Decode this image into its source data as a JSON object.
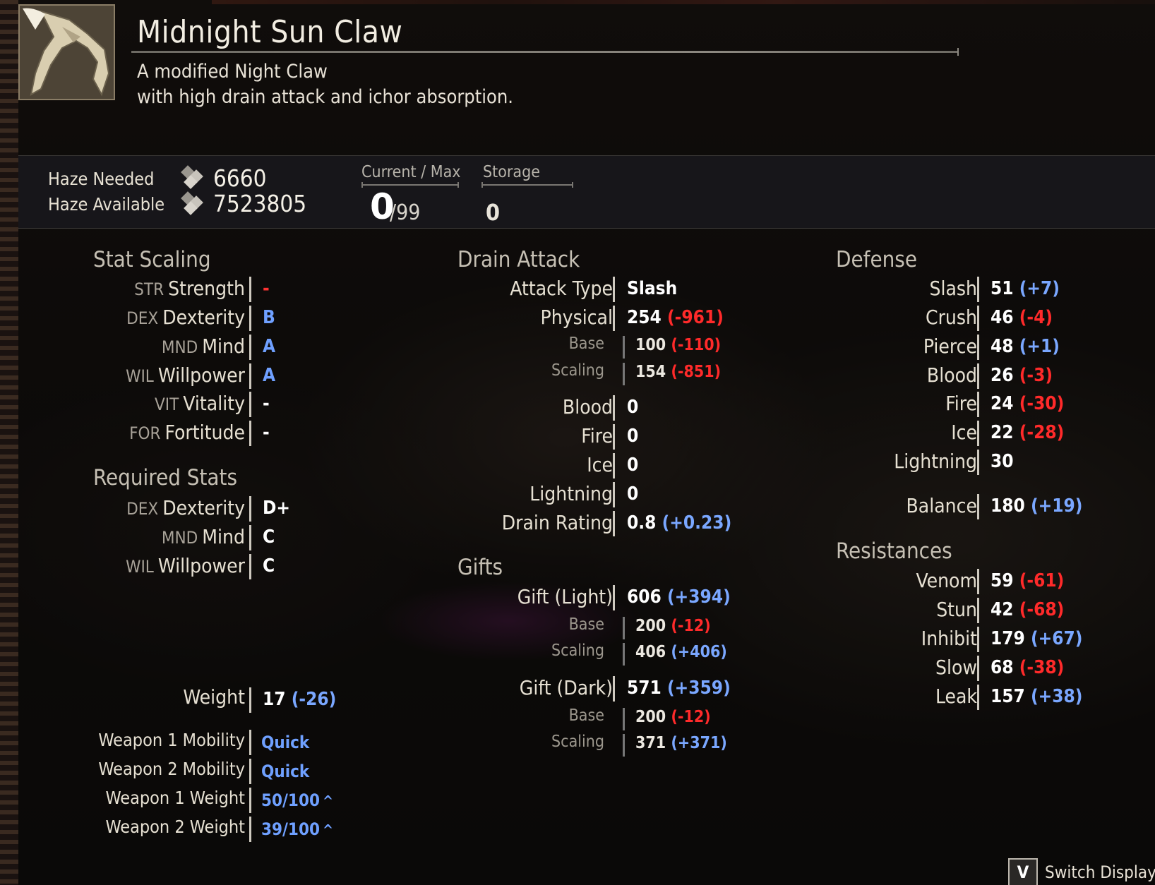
{
  "item": {
    "name": "Midnight Sun Claw",
    "description_line1": "A modified Night Claw",
    "description_line2": "with high drain attack and ichor absorption.",
    "icon": "claw-weapon-icon"
  },
  "haze": {
    "needed_label": "Haze Needed",
    "needed_value": "6660",
    "available_label": "Haze Available",
    "available_value": "7523805",
    "icon": "haze-crystal-icon",
    "current_max_label": "Current / Max",
    "current_value": "0",
    "max_value": "/99",
    "storage_label": "Storage",
    "storage_value": "0"
  },
  "stat_scaling": {
    "title": "Stat Scaling",
    "rows": [
      {
        "abbr": "STR",
        "name": "Strength",
        "value": "-",
        "color": "red"
      },
      {
        "abbr": "DEX",
        "name": "Dexterity",
        "value": "B",
        "color": "blue"
      },
      {
        "abbr": "MND",
        "name": "Mind",
        "value": "A",
        "color": "blue"
      },
      {
        "abbr": "WIL",
        "name": "Willpower",
        "value": "A",
        "color": "blue"
      },
      {
        "abbr": "VIT",
        "name": "Vitality",
        "value": "-",
        "color": "white"
      },
      {
        "abbr": "FOR",
        "name": "Fortitude",
        "value": "-",
        "color": "white"
      }
    ]
  },
  "required_stats": {
    "title": "Required Stats",
    "rows": [
      {
        "abbr": "DEX",
        "name": "Dexterity",
        "value": "D+"
      },
      {
        "abbr": "MND",
        "name": "Mind",
        "value": "C"
      },
      {
        "abbr": "WIL",
        "name": "Willpower",
        "value": "C"
      }
    ]
  },
  "weight": {
    "label": "Weight",
    "value": "17",
    "delta": "(-26)"
  },
  "mobility": [
    {
      "label": "Weapon 1 Mobility",
      "value": "Quick"
    },
    {
      "label": "Weapon 2 Mobility",
      "value": "Quick"
    },
    {
      "label": "Weapon 1 Weight",
      "value": "50/100",
      "arrow": "^"
    },
    {
      "label": "Weapon 2 Weight",
      "value": "39/100",
      "arrow": "^"
    }
  ],
  "drain_attack": {
    "title": "Drain Attack",
    "attack_type_label": "Attack Type",
    "attack_type_value": "Slash",
    "physical": {
      "label": "Physical",
      "value": "254",
      "delta": "(-961)"
    },
    "physical_base": {
      "label": "Base",
      "value": "100",
      "delta": "(-110)"
    },
    "physical_scaling": {
      "label": "Scaling",
      "value": "154",
      "delta": "(-851)"
    },
    "elements": [
      {
        "label": "Blood",
        "value": "0"
      },
      {
        "label": "Fire",
        "value": "0"
      },
      {
        "label": "Ice",
        "value": "0"
      },
      {
        "label": "Lightning",
        "value": "0"
      }
    ],
    "drain_rating": {
      "label": "Drain Rating",
      "value": "0.8",
      "delta": "(+0.23)"
    }
  },
  "gifts": {
    "title": "Gifts",
    "light": {
      "label": "Gift (Light)",
      "value": "606",
      "delta": "(+394)"
    },
    "light_base": {
      "label": "Base",
      "value": "200",
      "delta": "(-12)"
    },
    "light_scaling": {
      "label": "Scaling",
      "value": "406",
      "delta": "(+406)"
    },
    "dark": {
      "label": "Gift (Dark)",
      "value": "571",
      "delta": "(+359)"
    },
    "dark_base": {
      "label": "Base",
      "value": "200",
      "delta": "(-12)"
    },
    "dark_scaling": {
      "label": "Scaling",
      "value": "371",
      "delta": "(+371)"
    }
  },
  "defense": {
    "title": "Defense",
    "rows": [
      {
        "label": "Slash",
        "value": "51",
        "delta": "(+7)",
        "sign": "pos"
      },
      {
        "label": "Crush",
        "value": "46",
        "delta": "(-4)",
        "sign": "neg"
      },
      {
        "label": "Pierce",
        "value": "48",
        "delta": "(+1)",
        "sign": "pos"
      },
      {
        "label": "Blood",
        "value": "26",
        "delta": "(-3)",
        "sign": "neg"
      },
      {
        "label": "Fire",
        "value": "24",
        "delta": "(-30)",
        "sign": "neg"
      },
      {
        "label": "Ice",
        "value": "22",
        "delta": "(-28)",
        "sign": "neg"
      },
      {
        "label": "Lightning",
        "value": "30",
        "delta": "",
        "sign": ""
      }
    ],
    "balance": {
      "label": "Balance",
      "value": "180",
      "delta": "(+19)"
    }
  },
  "resistances": {
    "title": "Resistances",
    "rows": [
      {
        "label": "Venom",
        "value": "59",
        "delta": "(-61)",
        "sign": "neg"
      },
      {
        "label": "Stun",
        "value": "42",
        "delta": "(-68)",
        "sign": "neg"
      },
      {
        "label": "Inhibit",
        "value": "179",
        "delta": "(+67)",
        "sign": "pos"
      },
      {
        "label": "Slow",
        "value": "68",
        "delta": "(-38)",
        "sign": "neg"
      },
      {
        "label": "Leak",
        "value": "157",
        "delta": "(+38)",
        "sign": "pos"
      }
    ]
  },
  "footer": {
    "key": "V",
    "label": "Switch Display"
  }
}
